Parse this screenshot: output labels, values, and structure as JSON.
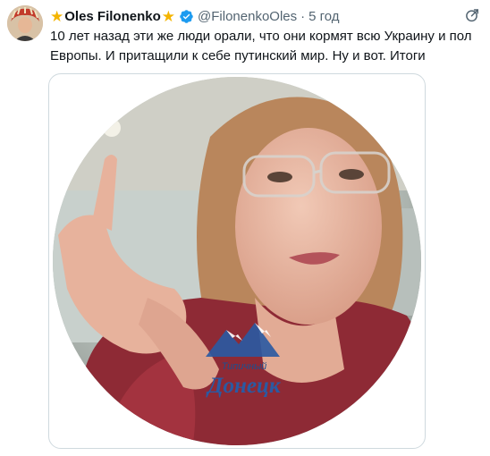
{
  "tweet": {
    "author": {
      "display_name": "Oles Filonenko",
      "handle": "@FilonenkoOles",
      "verified": true,
      "name_emoji": "star"
    },
    "separator": "·",
    "timestamp": "5 год",
    "text": "10 лет назад эти же люди орали, что они кормят всю Украину и пол Европы. И притащили к себе путинский мир. Ну и вот. Итоги",
    "media": {
      "type": "video",
      "shape": "circle",
      "watermark_line1": "Типичный",
      "watermark_line2": "Донецк"
    }
  },
  "icons": {
    "star": "star-emoji-icon",
    "verified": "verified-badge-icon",
    "more": "more-options-icon"
  },
  "colors": {
    "text": "#0f1419",
    "secondary": "#536471",
    "verified": "#1d9bf0",
    "star": "#f4b400",
    "border": "#cfd9de"
  }
}
